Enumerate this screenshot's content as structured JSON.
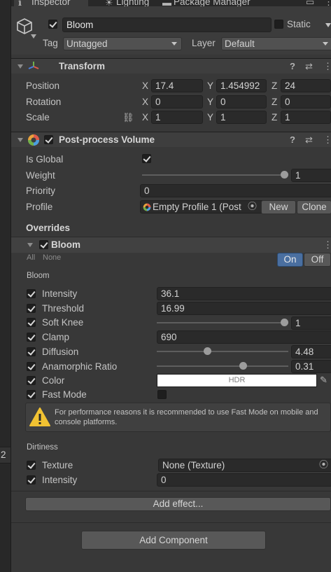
{
  "tabs": [
    {
      "label": "Inspector",
      "icon": "inspector-icon"
    },
    {
      "label": "Lighting",
      "icon": "lighting-icon"
    },
    {
      "label": "Package Manager",
      "icon": "package-icon"
    }
  ],
  "object": {
    "name": "Bloom",
    "static_label": "Static",
    "tag_label": "Tag",
    "tag_value": "Untagged",
    "layer_label": "Layer",
    "layer_value": "Default"
  },
  "transform": {
    "title": "Transform",
    "rows": [
      {
        "label": "Position",
        "x": "17.4",
        "y": "1.454992",
        "z": "24"
      },
      {
        "label": "Rotation",
        "x": "0",
        "y": "0",
        "z": "0"
      },
      {
        "label": "Scale",
        "x": "1",
        "y": "1",
        "z": "1"
      }
    ],
    "axis": {
      "x": "X",
      "y": "Y",
      "z": "Z"
    }
  },
  "ppv": {
    "title": "Post-process Volume",
    "is_global_label": "Is Global",
    "weight_label": "Weight",
    "weight_value": "1",
    "priority_label": "Priority",
    "priority_value": "0",
    "profile_label": "Profile",
    "profile_value": "Empty Profile 1 (Post",
    "new_label": "New",
    "clone_label": "Clone",
    "overrides_label": "Overrides",
    "weight": 1
  },
  "bloom": {
    "title": "Bloom",
    "all_label": "All",
    "none_label": "None",
    "on_label": "On",
    "off_label": "Off",
    "section_label": "Bloom",
    "intensity_label": "Intensity",
    "intensity_value": "36.1",
    "threshold_label": "Threshold",
    "threshold_value": "16.99",
    "softknee_label": "Soft Knee",
    "softknee_value": "1",
    "clamp_label": "Clamp",
    "clamp_value": "690",
    "diffusion_label": "Diffusion",
    "diffusion_value": "4.48",
    "anamorphic_label": "Anamorphic Ratio",
    "anamorphic_value": "0.31",
    "color_label": "Color",
    "color_value": "HDR",
    "fastmode_label": "Fast Mode",
    "warning": "For performance reasons it is recommended to use Fast Mode on mobile and console platforms.",
    "dirtiness_label": "Dirtiness",
    "texture_label": "Texture",
    "texture_value": "None (Texture)",
    "dirt_intensity_label": "Intensity",
    "dirt_intensity_value": "0",
    "soft_knee": 1,
    "diffusion": 4.48,
    "anamorphic": 0.31
  },
  "add_effect_label": "Add effect...",
  "add_component_label": "Add Component",
  "left_panel_value": "2",
  "colors": {
    "background": "#383838",
    "field": "#2a2a2a",
    "active_toggle": "#4a6fa0",
    "warning_icon": "#f1c232"
  }
}
